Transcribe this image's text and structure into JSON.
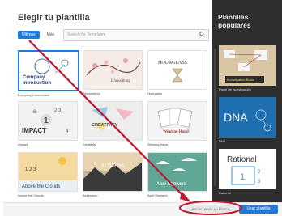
{
  "dialog": {
    "title": "Elegir tu plantilla",
    "tabs": [
      "Últimas",
      "Más"
    ],
    "search_placeholder": "Search for Templates"
  },
  "templates": [
    {
      "label": "Company Introduction",
      "thumb_text": "Company Introduction"
    },
    {
      "label": "Blossoming",
      "thumb_text": "Blossoming"
    },
    {
      "label": "Hourglass",
      "thumb_text": "HOURGLASS"
    },
    {
      "label": "Impact",
      "thumb_text": "IMPACT"
    },
    {
      "label": "Creativity",
      "thumb_text": "CREATIVITY"
    },
    {
      "label": "Winning Hand",
      "thumb_text": "Winning Hand"
    },
    {
      "label": "Above the Clouds",
      "thumb_text": "Above the Clouds"
    },
    {
      "label": "Ascension",
      "thumb_text": "SUNRISE"
    },
    {
      "label": "April Showers",
      "thumb_text": "April Showers"
    }
  ],
  "popular": {
    "title": "Plantillas populares",
    "items": [
      {
        "label": "Panel de investigación",
        "thumb_text": "Investigation Board"
      },
      {
        "label": "DNA",
        "thumb_text": "DNA"
      },
      {
        "label": "Rational",
        "thumb_text": "Rational"
      }
    ]
  },
  "footer": {
    "preview_label": "Iniciar previo en blanco",
    "use_label": "Usar plantilla"
  },
  "colors": {
    "accent": "#1f7ad8",
    "annotation": "#c0162e"
  }
}
